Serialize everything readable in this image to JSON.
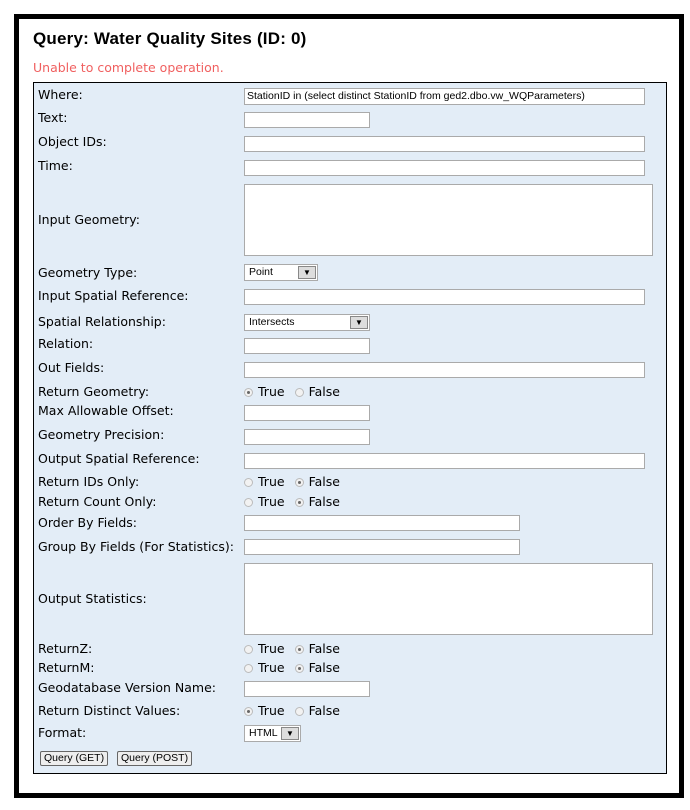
{
  "title": "Query: Water Quality Sites (ID: 0)",
  "error": "Unable to complete operation.",
  "radio_true": "True",
  "radio_false": "False",
  "fields": [
    {
      "name": "where",
      "label": "Where:",
      "type": "text",
      "value": "StationID in (select distinct StationID from ged2.dbo.vw_WQParameters)"
    },
    {
      "name": "text",
      "label": "Text:",
      "type": "text",
      "value": ""
    },
    {
      "name": "object-ids",
      "label": "Object IDs:",
      "type": "text",
      "value": ""
    },
    {
      "name": "time",
      "label": "Time:",
      "type": "text",
      "value": ""
    },
    {
      "name": "input-geometry",
      "label": "Input Geometry:",
      "type": "textarea",
      "value": ""
    },
    {
      "name": "geometry-type",
      "label": "Geometry Type:",
      "type": "select",
      "value": "Point"
    },
    {
      "name": "input-spatial-reference",
      "label": "Input Spatial Reference:",
      "type": "text",
      "value": ""
    },
    {
      "name": "spatial-relationship",
      "label": "Spatial Relationship:",
      "type": "select",
      "value": "Intersects"
    },
    {
      "name": "relation",
      "label": "Relation:",
      "type": "text",
      "value": ""
    },
    {
      "name": "out-fields",
      "label": "Out Fields:",
      "type": "text",
      "value": ""
    },
    {
      "name": "return-geometry",
      "label": "Return Geometry:",
      "type": "radio",
      "value": true
    },
    {
      "name": "max-allowable-offset",
      "label": "Max Allowable Offset:",
      "type": "text",
      "value": ""
    },
    {
      "name": "geometry-precision",
      "label": "Geometry Precision:",
      "type": "text",
      "value": ""
    },
    {
      "name": "output-spatial-reference",
      "label": "Output Spatial Reference:",
      "type": "text",
      "value": ""
    },
    {
      "name": "return-ids-only",
      "label": "Return IDs Only:",
      "type": "radio",
      "value": false
    },
    {
      "name": "return-count-only",
      "label": "Return Count Only:",
      "type": "radio",
      "value": false
    },
    {
      "name": "order-by-fields",
      "label": "Order By Fields:",
      "type": "text",
      "value": ""
    },
    {
      "name": "group-by-fields",
      "label": "Group By Fields (For Statistics):",
      "type": "text",
      "value": ""
    },
    {
      "name": "output-statistics",
      "label": "Output Statistics:",
      "type": "textarea",
      "value": ""
    },
    {
      "name": "return-z",
      "label": "ReturnZ:",
      "type": "radio",
      "value": false
    },
    {
      "name": "return-m",
      "label": "ReturnM:",
      "type": "radio",
      "value": false
    },
    {
      "name": "geodatabase-version-name",
      "label": "Geodatabase Version Name:",
      "type": "text",
      "value": ""
    },
    {
      "name": "return-distinct-values",
      "label": "Return Distinct Values:",
      "type": "radio",
      "value": true
    },
    {
      "name": "format",
      "label": "Format:",
      "type": "select",
      "value": "HTML"
    }
  ],
  "buttons": {
    "get": "Query (GET)",
    "post": "Query (POST)"
  }
}
